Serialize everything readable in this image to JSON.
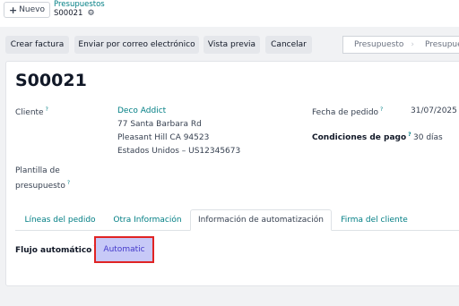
{
  "header": {
    "new_button": "Nuevo",
    "breadcrumb_parent": "Presupuestos",
    "breadcrumb_current": "S00021"
  },
  "actions": {
    "confirm": "Crear factura",
    "email": "Enviar por correo electrónico",
    "preview": "Vista previa",
    "cancel": "Cancelar"
  },
  "statusbar": [
    "Presupuesto",
    "Presupue"
  ],
  "record": {
    "title": "S00021",
    "customer_label": "Cliente",
    "customer_name": "Deco Addict",
    "address_line1": "77 Santa Barbara Rd",
    "address_line2": "Pleasant Hill CA 94523",
    "address_line3": "Estados Unidos – US12345673",
    "template_label_1": "Plantilla de",
    "template_label_2": "presupuesto",
    "order_date_label": "Fecha de pedido",
    "order_date": "31/07/2025",
    "payment_terms_label": "Condiciones de pago",
    "payment_terms": "30 días"
  },
  "tabs": [
    "Líneas del pedido",
    "Otra Información",
    "Información de automatización",
    "Firma del cliente"
  ],
  "automation": {
    "flow_label": "Flujo automático",
    "flow_value": "Automatic"
  },
  "colors": {
    "accent": "#017e84",
    "highlight_fill": "#c7c9f7",
    "highlight_border": "#e02424"
  }
}
